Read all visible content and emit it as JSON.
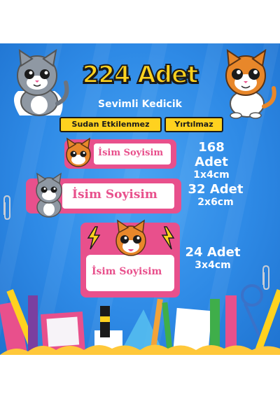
{
  "header": {
    "title": "224 Adet",
    "subtitle": "Sevimli Kedicik",
    "badges": [
      "Sudan Etkilenmez",
      "Yırtılmaz"
    ]
  },
  "labels": [
    {
      "name": "İsim Soyisim",
      "count": "168 Adet",
      "size": "1x4cm"
    },
    {
      "name": "İsim Soyisim",
      "count": "32 Adet",
      "size": "2x6cm"
    },
    {
      "name": "İsim Soyisim",
      "count": "24 Adet",
      "size": "3x4cm"
    }
  ],
  "colors": {
    "background": "#2e8ae6",
    "accent_yellow": "#ffd21f",
    "label_pink": "#e8508c",
    "white": "#ffffff"
  },
  "icons": [
    "gray-cat-icon",
    "orange-cat-icon",
    "school-supplies-icon"
  ]
}
